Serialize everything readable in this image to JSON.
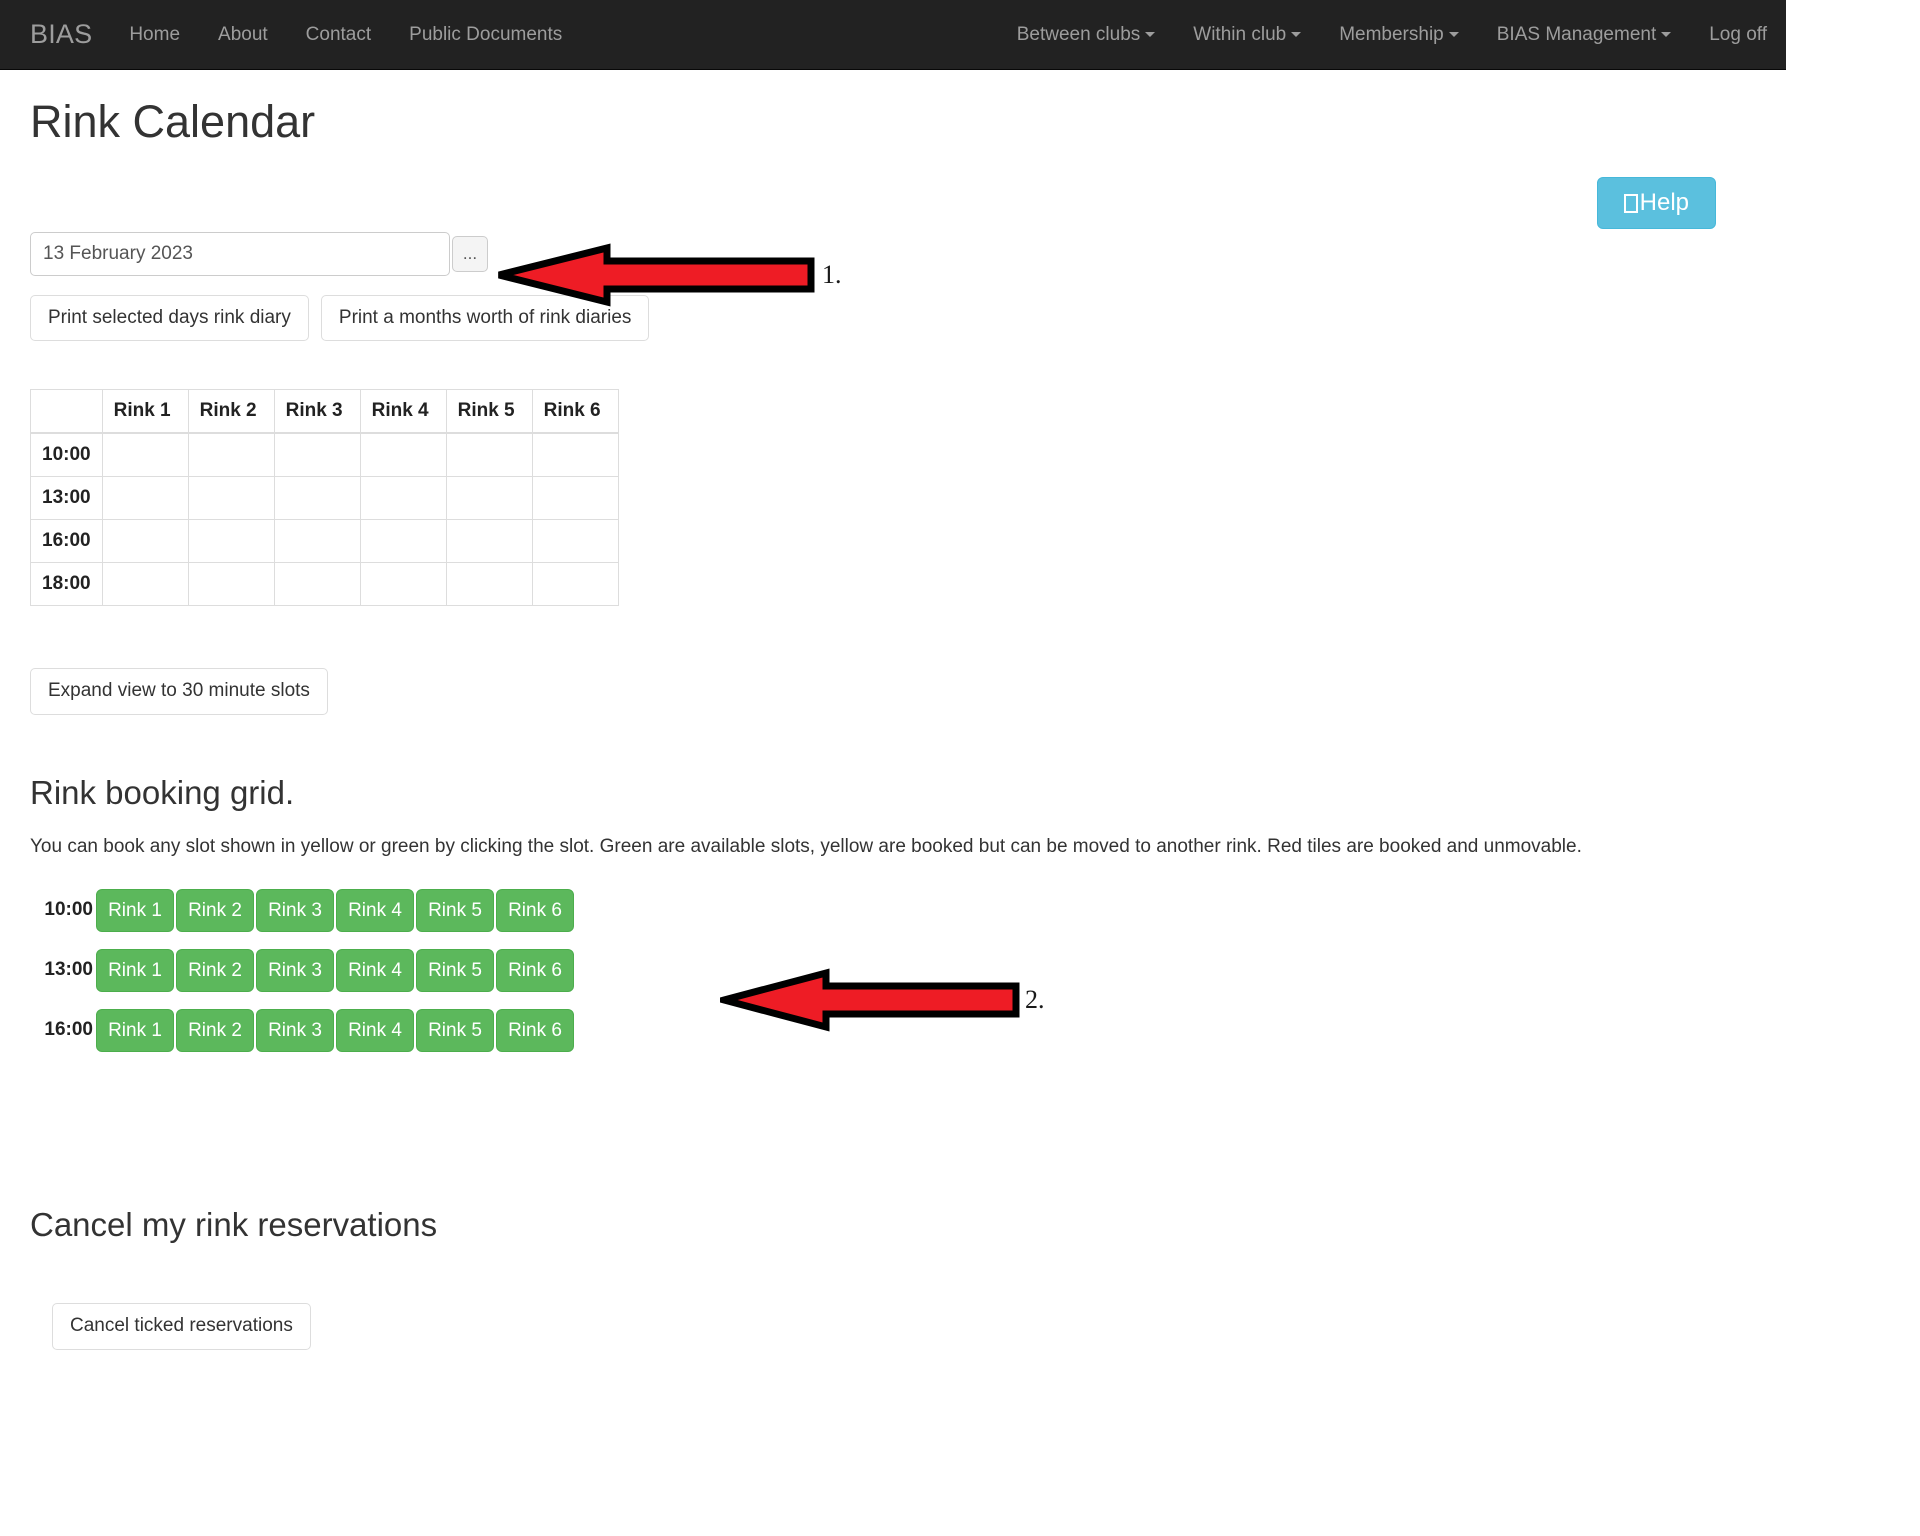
{
  "navbar": {
    "brand": "BIAS",
    "left_items": [
      {
        "label": "Home"
      },
      {
        "label": "About"
      },
      {
        "label": "Contact"
      },
      {
        "label": "Public Documents"
      }
    ],
    "right_items": [
      {
        "label": "Between clubs",
        "caret": true
      },
      {
        "label": "Within club",
        "caret": true
      },
      {
        "label": "Membership",
        "caret": true
      },
      {
        "label": "BIAS Management",
        "caret": true
      },
      {
        "label": "Log off",
        "caret": false
      }
    ]
  },
  "page": {
    "title": "Rink Calendar"
  },
  "help": {
    "label": "Help",
    "icon": "missing-glyph-box",
    "color": "#5bc0de"
  },
  "date_picker": {
    "value": "13 February 2023",
    "placeholder": "13 February 2023",
    "ellipsis_label": "..."
  },
  "print": {
    "selected_day_label": "Print selected days rink diary",
    "month_label": "Print a months worth of rink diaries"
  },
  "rink_table": {
    "corner_header": "",
    "columns": [
      "Rink 1",
      "Rink 2",
      "Rink 3",
      "Rink 4",
      "Rink 5",
      "Rink 6"
    ],
    "rows": [
      {
        "time": "10:00",
        "cells": [
          "",
          "",
          "",
          "",
          "",
          ""
        ]
      },
      {
        "time": "13:00",
        "cells": [
          "",
          "",
          "",
          "",
          "",
          ""
        ]
      },
      {
        "time": "16:00",
        "cells": [
          "",
          "",
          "",
          "",
          "",
          ""
        ]
      },
      {
        "time": "18:00",
        "cells": [
          "",
          "",
          "",
          "",
          "",
          ""
        ]
      }
    ]
  },
  "expand": {
    "label": "Expand view to 30 minute slots"
  },
  "booking_grid": {
    "title": "Rink booking grid.",
    "description": "You can book any slot shown in yellow or green by clicking the slot. Green are available slots, yellow are booked but can be moved to another rink. Red tiles are booked and unmovable.",
    "legend_colors": {
      "available_green": "#5cb85c",
      "booked_movable_yellow": "#f0ad4e",
      "booked_fixed_red": "#d9534f"
    },
    "rows": [
      {
        "time": "10:00",
        "slots": [
          {
            "label": "Rink 1",
            "state": "available"
          },
          {
            "label": "Rink 2",
            "state": "available"
          },
          {
            "label": "Rink 3",
            "state": "available"
          },
          {
            "label": "Rink 4",
            "state": "available"
          },
          {
            "label": "Rink 5",
            "state": "available"
          },
          {
            "label": "Rink 6",
            "state": "available"
          }
        ]
      },
      {
        "time": "13:00",
        "slots": [
          {
            "label": "Rink 1",
            "state": "available"
          },
          {
            "label": "Rink 2",
            "state": "available"
          },
          {
            "label": "Rink 3",
            "state": "available"
          },
          {
            "label": "Rink 4",
            "state": "available"
          },
          {
            "label": "Rink 5",
            "state": "available"
          },
          {
            "label": "Rink 6",
            "state": "available"
          }
        ]
      },
      {
        "time": "16:00",
        "slots": [
          {
            "label": "Rink 1",
            "state": "available"
          },
          {
            "label": "Rink 2",
            "state": "available"
          },
          {
            "label": "Rink 3",
            "state": "available"
          },
          {
            "label": "Rink 4",
            "state": "available"
          },
          {
            "label": "Rink 5",
            "state": "available"
          },
          {
            "label": "Rink 6",
            "state": "available"
          }
        ]
      }
    ]
  },
  "cancel": {
    "title": "Cancel my rink reservations",
    "button_label": "Cancel ticked reservations"
  },
  "annotations": [
    {
      "number": "1.",
      "color": "#ee1c25",
      "points_to": "date-picker-ellipsis-button"
    },
    {
      "number": "2.",
      "color": "#ee1c25",
      "points_to": "booking-grid-row-10-00"
    }
  ]
}
